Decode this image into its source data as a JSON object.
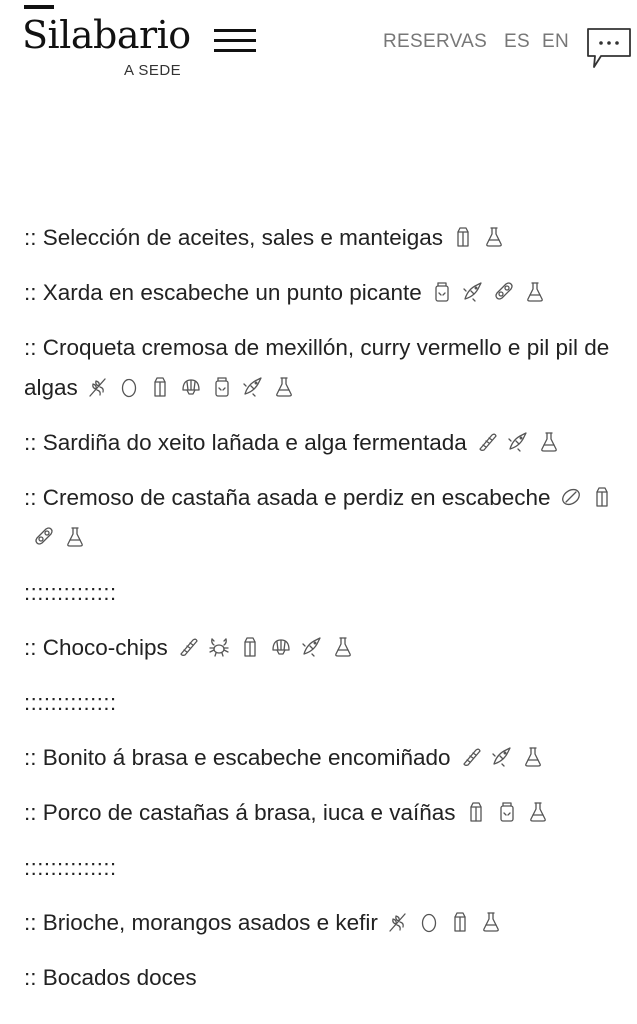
{
  "header": {
    "logo": "Silabario",
    "logo_sub": "A SEDE",
    "nav": {
      "reservas": "RESERVAS",
      "es": "ES",
      "en": "EN"
    }
  },
  "menu": {
    "items": [
      {
        "type": "dish",
        "text": ":: Selección de aceites, sales e manteigas",
        "allergens": [
          "milk-icon",
          "sulphites-icon"
        ]
      },
      {
        "type": "dish",
        "text": ":: Xarda en escabeche un punto picante",
        "allergens": [
          "mustard-icon",
          "fish-icon",
          "soy-icon",
          "sulphites-icon"
        ]
      },
      {
        "type": "dish",
        "text": ":: Croqueta cremosa de mexillón, curry vermello e pil pil de algas",
        "allergens": [
          "gluten-icon",
          "egg-icon",
          "milk-icon",
          "mollusc-icon",
          "mustard-icon",
          "fish-icon",
          "sulphites-icon"
        ]
      },
      {
        "type": "dish",
        "text": ":: Sardiña do xeito lañada e alga fermentada",
        "allergens": [
          "celery-icon",
          "fish-icon",
          "sulphites-icon"
        ]
      },
      {
        "type": "dish",
        "text": ":: Cremoso de castaña asada e perdiz en escabeche",
        "allergens": [
          "nuts-icon",
          "milk-icon",
          "soy-icon",
          "sulphites-icon"
        ]
      },
      {
        "type": "sep",
        "text": "::::::::::::::"
      },
      {
        "type": "dish",
        "text": ":: Choco-chips",
        "allergens": [
          "celery-icon",
          "crustacean-icon",
          "milk-icon",
          "mollusc-icon",
          "fish-icon",
          "sulphites-icon"
        ]
      },
      {
        "type": "sep",
        "text": "::::::::::::::"
      },
      {
        "type": "dish",
        "text": ":: Bonito á brasa e escabeche encomiñado",
        "allergens": [
          "celery-icon",
          "fish-icon",
          "sulphites-icon"
        ]
      },
      {
        "type": "dish",
        "text": ":: Porco de castañas á brasa, iuca e vaíñas",
        "allergens": [
          "milk-icon",
          "mustard-icon",
          "sulphites-icon"
        ]
      },
      {
        "type": "sep",
        "text": "::::::::::::::"
      },
      {
        "type": "dish",
        "text": ":: Brioche, morangos asados e kefir",
        "allergens": [
          "gluten-icon",
          "egg-icon",
          "milk-icon",
          "sulphites-icon"
        ]
      },
      {
        "type": "dish",
        "text": ":: Bocados doces",
        "allergens": []
      }
    ]
  }
}
